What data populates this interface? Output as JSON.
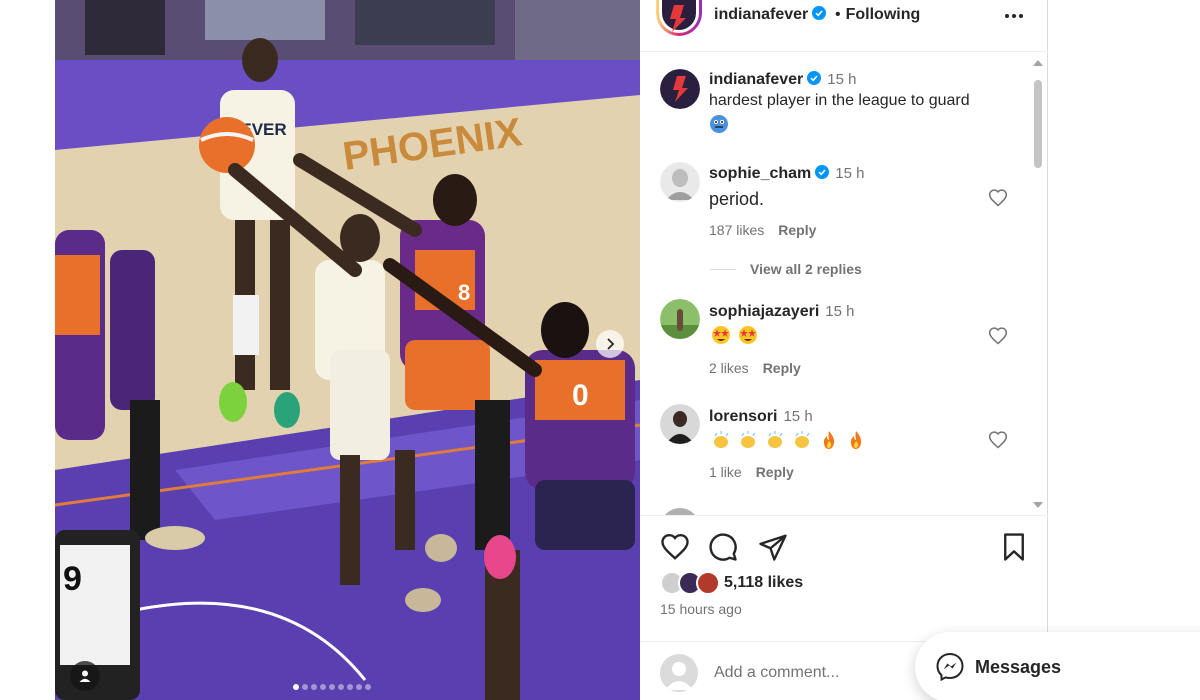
{
  "post": {
    "username": "indianafever",
    "follow_state": "Following",
    "likes": "5,118 likes",
    "time_ago": "15 hours ago",
    "add_comment_placeholder": "Add a comment..."
  },
  "caption": {
    "username": "indianafever",
    "time": "15 h",
    "text": "hardest player in the league to guard",
    "emoji": "face-icon"
  },
  "comments": [
    {
      "username": "sophie_cham",
      "verified": true,
      "time": "15 h",
      "text": "period.",
      "likes": "187 likes",
      "reply": "Reply",
      "view_replies": "View all 2 replies"
    },
    {
      "username": "sophiajazayeri",
      "verified": false,
      "time": "15 h",
      "text": "",
      "emojis": [
        "star-struck-icon",
        "star-struck-icon"
      ],
      "likes": "2 likes",
      "reply": "Reply"
    },
    {
      "username": "lorensori",
      "verified": false,
      "time": "15 h",
      "text": "",
      "emojis": [
        "clap-icon",
        "clap-icon",
        "clap-icon",
        "clap-icon",
        "fire-icon",
        "fire-icon"
      ],
      "likes": "1 like",
      "reply": "Reply"
    }
  ],
  "carousel": {
    "dots": 9,
    "active_index": 0
  },
  "messages": {
    "label": "Messages"
  },
  "colors": {
    "verified": "#0095f6",
    "muted": "#737373",
    "text": "#262626",
    "phoenix_orange": "#e8702a",
    "court_purple": "#5a3fb0"
  }
}
